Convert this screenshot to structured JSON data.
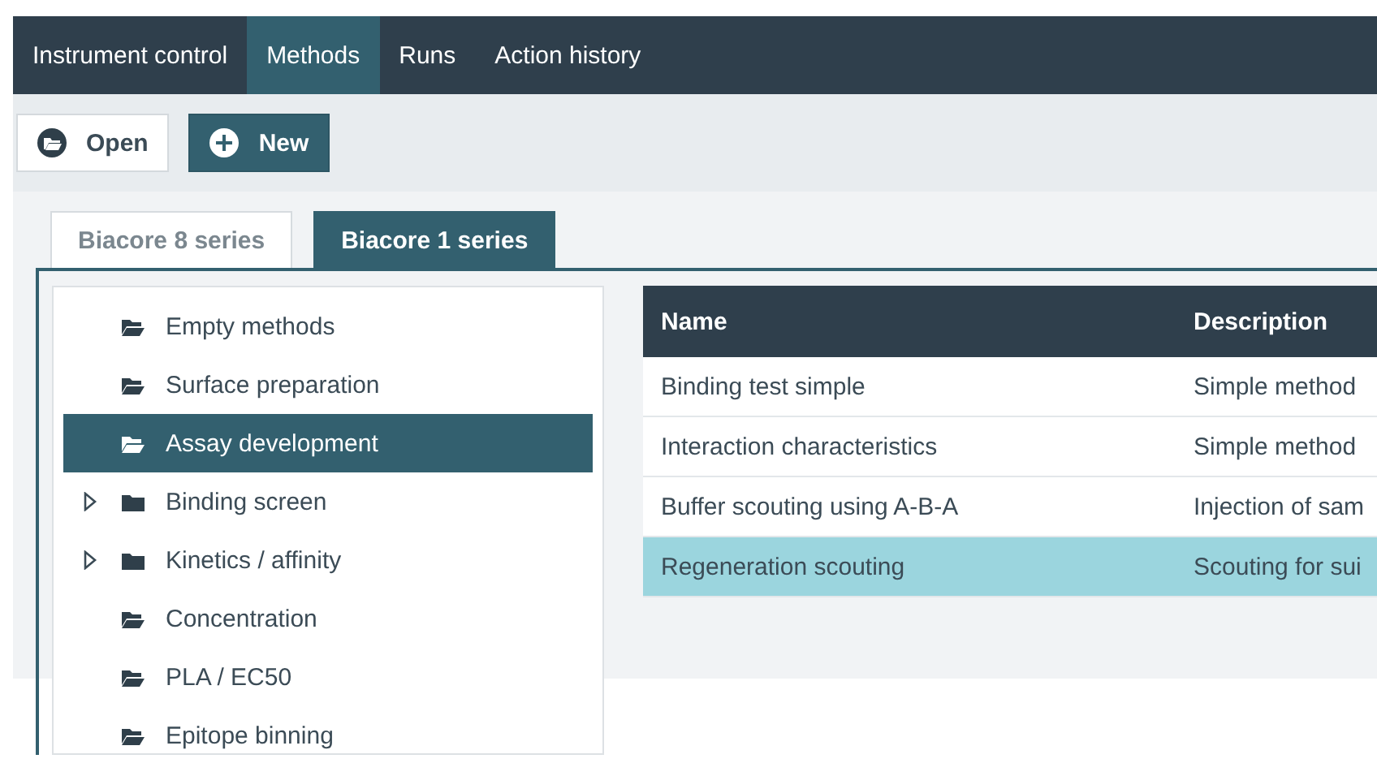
{
  "nav_tabs": [
    {
      "label": "Instrument control",
      "selected": false
    },
    {
      "label": "Methods",
      "selected": true
    },
    {
      "label": "Runs",
      "selected": false
    },
    {
      "label": "Action history",
      "selected": false
    }
  ],
  "toolbar": [
    {
      "label": "Open",
      "kind": "open"
    },
    {
      "label": "New",
      "kind": "new"
    }
  ],
  "series_tabs": [
    {
      "label": "Biacore 8 series",
      "selected": false
    },
    {
      "label": "Biacore 1 series",
      "selected": true
    }
  ],
  "tree": [
    {
      "label": "Empty methods",
      "expandable": false,
      "selected": false
    },
    {
      "label": "Surface preparation",
      "expandable": false,
      "selected": false
    },
    {
      "label": "Assay development",
      "expandable": false,
      "selected": true
    },
    {
      "label": "Binding screen",
      "expandable": true,
      "selected": false
    },
    {
      "label": "Kinetics / affinity",
      "expandable": true,
      "selected": false
    },
    {
      "label": "Concentration",
      "expandable": false,
      "selected": false
    },
    {
      "label": "PLA / EC50",
      "expandable": false,
      "selected": false
    },
    {
      "label": "Epitope binning",
      "expandable": false,
      "selected": false
    }
  ],
  "table": {
    "columns": [
      "Name",
      "Description"
    ],
    "rows": [
      {
        "cells": [
          "Binding test simple",
          "Simple method"
        ],
        "selected": false
      },
      {
        "cells": [
          "Interaction characteristics",
          "Simple method"
        ],
        "selected": false
      },
      {
        "cells": [
          "Buffer scouting using A-B-A",
          "Injection of sam"
        ],
        "selected": false
      },
      {
        "cells": [
          "Regeneration scouting",
          "Scouting for sui"
        ],
        "selected": true
      }
    ]
  }
}
